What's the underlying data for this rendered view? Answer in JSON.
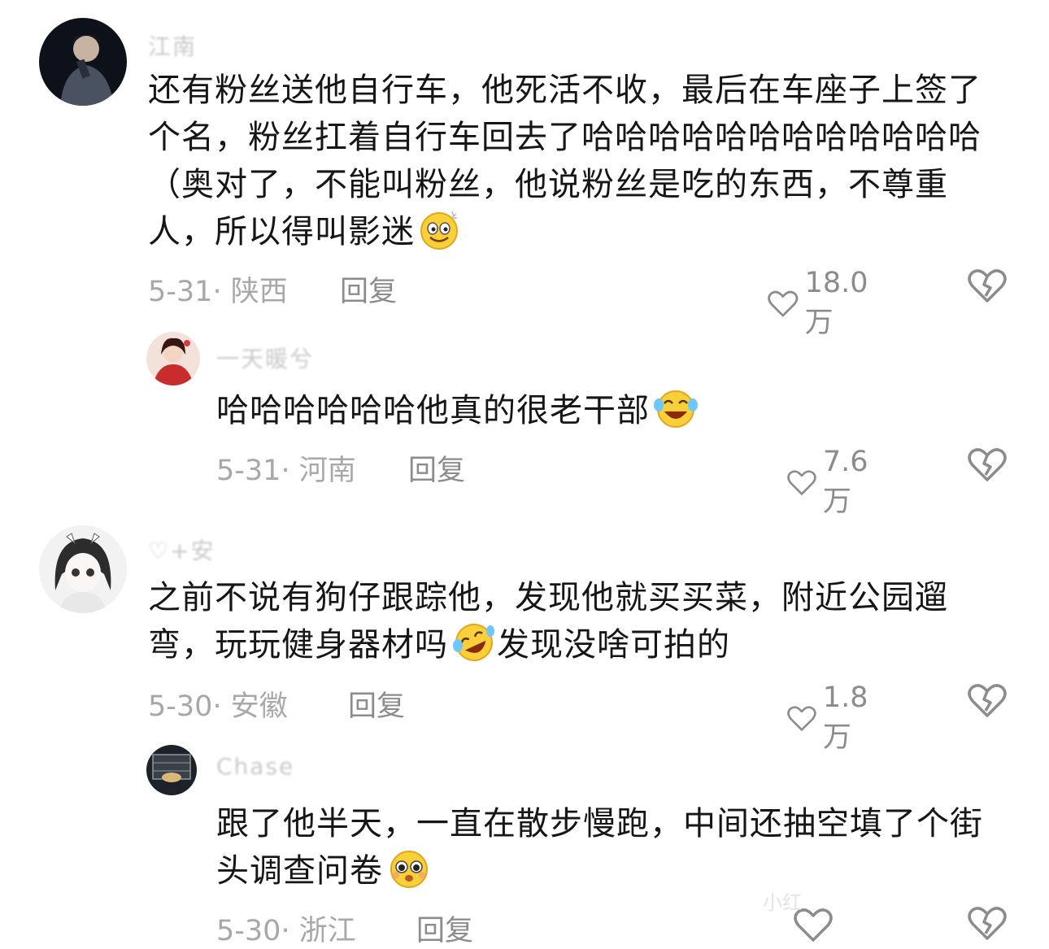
{
  "comments": [
    {
      "username": "江南",
      "text": "还有粉丝送他自行车，他死活不收，最后在车座子上签了个名，粉丝扛着自行车回去了哈哈哈哈哈哈哈哈哈哈哈哈（奥对了，不能叫粉丝，他说粉丝是吃的东西，不尊重人，所以得叫影迷",
      "emoji": "smile-sweat-emoji",
      "date": "5-31",
      "location": "陕西",
      "reply_label": "回复",
      "likes": "18.0万"
    },
    {
      "username": "一天暖兮",
      "text": "哈哈哈哈哈哈他真的很老干部",
      "emoji": "laugh-cry-emoji",
      "date": "5-31",
      "location": "河南",
      "reply_label": "回复",
      "likes": "7.6万"
    },
    {
      "username": "♡+安",
      "text": "之前不说有狗仔跟踪他，发现他就买买菜，附近公园遛弯，玩玩健身器材吗",
      "text_after_emoji": "发现没啥可拍的",
      "emoji": "rofl-emoji",
      "date": "5-30",
      "location": "安徽",
      "reply_label": "回复",
      "likes": "1.8万"
    },
    {
      "username": "Chase",
      "text": "跟了他半天，一直在散步慢跑，中间还抽空填了个街头调查问卷",
      "emoji": "pleading-emoji",
      "date": "5-30",
      "location": "浙江",
      "reply_label": "回复",
      "likes": ""
    }
  ],
  "watermark": "小红",
  "colors": {
    "text": "#161616",
    "meta": "#a8a8a8",
    "icon": "#8c8c8c"
  }
}
